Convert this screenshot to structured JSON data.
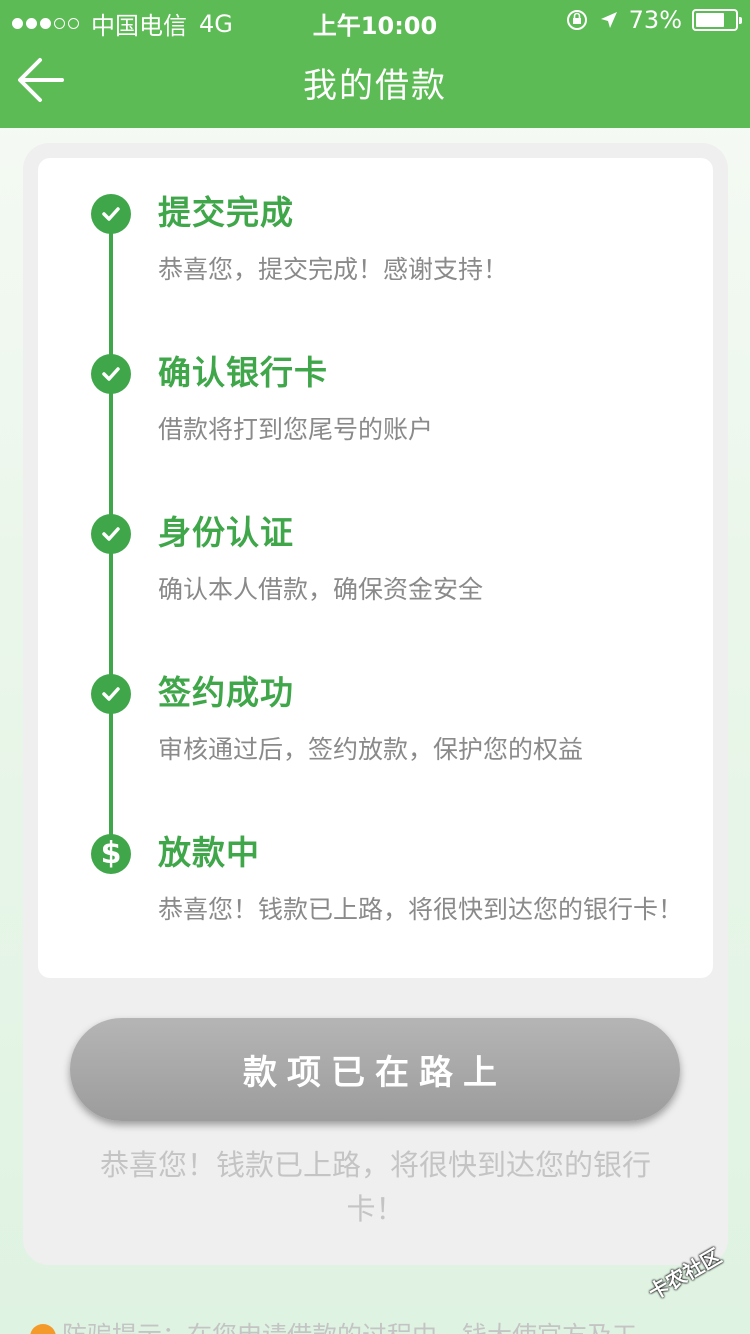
{
  "status_bar": {
    "carrier": "中国电信",
    "network": "4G",
    "time": "上午10:00",
    "battery": "73%",
    "battery_level": 0.73
  },
  "nav": {
    "title": "我的借款",
    "back_icon": "arrow-left-icon"
  },
  "steps": [
    {
      "title": "提交完成",
      "desc": "恭喜您，提交完成！感谢支持！",
      "icon": "check-icon"
    },
    {
      "title": "确认银行卡",
      "desc": "借款将打到您尾号的账户",
      "icon": "check-icon"
    },
    {
      "title": "身份认证",
      "desc": "确认本人借款，确保资金安全",
      "icon": "check-icon"
    },
    {
      "title": "签约成功",
      "desc": "审核通过后，签约放款，保护您的权益",
      "icon": "check-icon"
    },
    {
      "title": "放款中",
      "desc": "恭喜您！钱款已上路，将很快到达您的银行卡！",
      "icon": "dollar-icon"
    }
  ],
  "button": {
    "label": "款项已在路上"
  },
  "hint": "恭喜您！钱款已上路，将很快到达您的银行卡！",
  "footer_tip": "防骗提示：在您申请借款的过程中，钱大使官方及工",
  "watermark": "卡农社区",
  "colors": {
    "header_green": "#5cbb55",
    "step_green": "#3fa64a",
    "button_gray": "#a8a8a8"
  }
}
